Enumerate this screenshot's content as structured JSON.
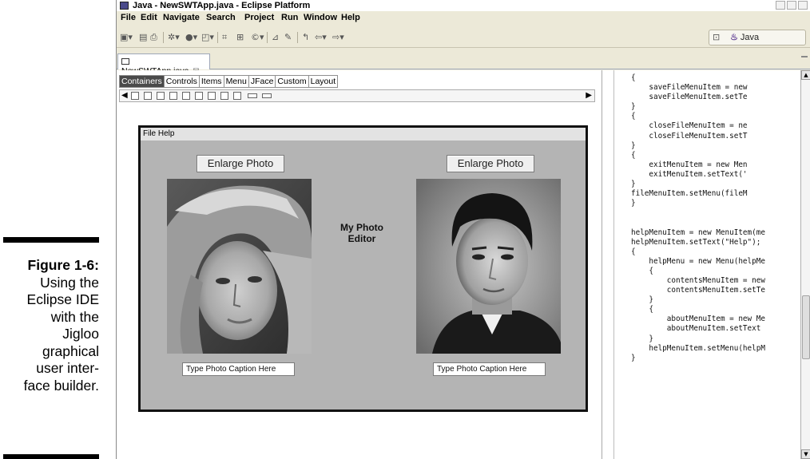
{
  "figure": {
    "label": "Figure 1-6:",
    "lines": [
      "Using the",
      "Eclipse IDE",
      "with the",
      "Jigloo",
      "graphical",
      "user inter-",
      "face builder."
    ]
  },
  "window": {
    "title": "Java - NewSWTApp.java - Eclipse Platform"
  },
  "menubar": {
    "items": [
      "File",
      "Edit",
      "Navigate",
      "Search",
      "Project",
      "Run",
      "Window",
      "Help"
    ]
  },
  "perspective": {
    "label": "Java"
  },
  "editor_tab": {
    "label": "NewSWTApp.java",
    "close": "☒"
  },
  "palette": {
    "tabs": [
      "Containers",
      "Controls",
      "Items",
      "Menu",
      "JFace",
      "Custom",
      "Layout"
    ],
    "active_tab": "Containers"
  },
  "app": {
    "menu": "File  Help",
    "left_button": "Enlarge Photo",
    "right_button": "Enlarge Photo",
    "title": "My Photo Editor",
    "title_line1": "My Photo",
    "title_line2": "Editor",
    "left_caption": "Type Photo Caption Here",
    "right_caption": "Type Photo Caption Here"
  },
  "code_lines": [
    "{",
    "    saveFileMenuItem = new",
    "    saveFileMenuItem.setTe",
    "}",
    "{",
    "    closeFileMenuItem = ne",
    "    closeFileMenuItem.setT",
    "}",
    "{",
    "    exitMenuItem = new Men",
    "    exitMenuItem.setText('",
    "}",
    "fileMenuItem.setMenu(fileM",
    "}",
    "",
    "",
    "helpMenuItem = new MenuItem(me",
    "helpMenuItem.setText(\"Help\");",
    "{",
    "    helpMenu = new Menu(helpMe",
    "    {",
    "        contentsMenuItem = new",
    "        contentsMenuItem.setTe",
    "    }",
    "    {",
    "        aboutMenuItem = new Me",
    "        aboutMenuItem.setText",
    "    }",
    "    helpMenuItem.setMenu(helpM",
    "}"
  ]
}
